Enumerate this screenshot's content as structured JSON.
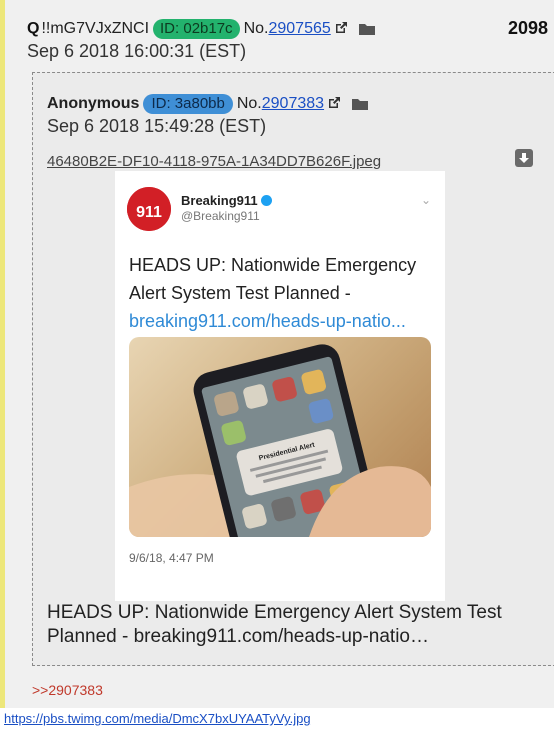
{
  "post": {
    "name": "Q",
    "tripcode": "!!mG7VJxZNCI",
    "id_label": "ID: 02b17c",
    "no_label": "No.",
    "number": "2907565",
    "date": "Sep 6 2018 16:00:31 (EST)",
    "count": "2098",
    "colors": {
      "id_pill": "#23b26d",
      "border": "#ede77a"
    }
  },
  "quoted": {
    "name": "Anonymous",
    "id_label": "ID: 3a80bb",
    "no_label": "No.",
    "number": "2907383",
    "date": "Sep 6 2018 15:49:28 (EST)",
    "filename": "46480B2E-DF10-4118-975A-1A34DD7B626F.jpeg",
    "colors": {
      "id_pill": "#3f8fd6"
    },
    "tweet": {
      "display_name": "Breaking911",
      "handle": "@Breaking911",
      "text": "HEADS UP: Nationwide Emergency Alert System Test Planned -",
      "link": "breaking911.com/heads-up-natio...",
      "timestamp": "9/6/18, 4:47 PM",
      "alert_title": "Presidential Alert"
    },
    "caption": "HEADS UP: Nationwide Emergency Alert System Test Planned - breaking911.com/heads-up-natio…"
  },
  "reply": ">>2907383",
  "media_url": "https://pbs.twimg.com/media/DmcX7bxUYAATyVy.jpg"
}
